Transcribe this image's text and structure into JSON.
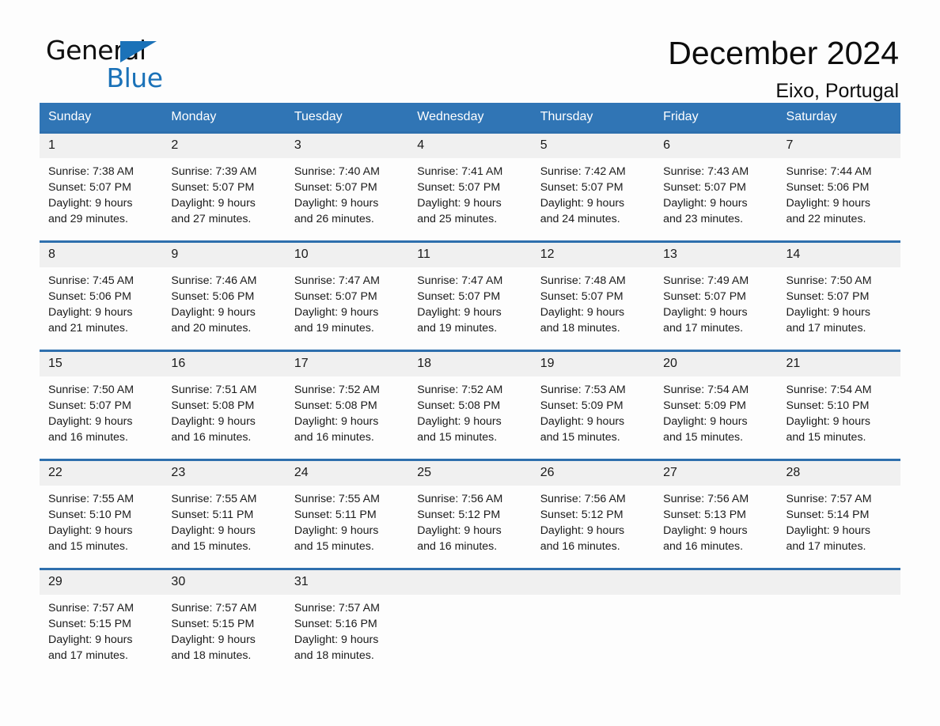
{
  "brand": {
    "name_part1": "General",
    "name_part2": "Blue",
    "triangle_color": "#1b72b8"
  },
  "header": {
    "title": "December 2024",
    "location": "Eixo, Portugal"
  },
  "theme": {
    "header_blue": "#3075b5",
    "row_border_blue": "#2e6fad",
    "daynum_band": "#f0f0f0",
    "page_background": "#fdfdfd"
  },
  "weekday_headers": [
    "Sunday",
    "Monday",
    "Tuesday",
    "Wednesday",
    "Thursday",
    "Friday",
    "Saturday"
  ],
  "weeks": [
    [
      {
        "day": "1",
        "sunrise": "Sunrise: 7:38 AM",
        "sunset": "Sunset: 5:07 PM",
        "daylight1": "Daylight: 9 hours",
        "daylight2": "and 29 minutes."
      },
      {
        "day": "2",
        "sunrise": "Sunrise: 7:39 AM",
        "sunset": "Sunset: 5:07 PM",
        "daylight1": "Daylight: 9 hours",
        "daylight2": "and 27 minutes."
      },
      {
        "day": "3",
        "sunrise": "Sunrise: 7:40 AM",
        "sunset": "Sunset: 5:07 PM",
        "daylight1": "Daylight: 9 hours",
        "daylight2": "and 26 minutes."
      },
      {
        "day": "4",
        "sunrise": "Sunrise: 7:41 AM",
        "sunset": "Sunset: 5:07 PM",
        "daylight1": "Daylight: 9 hours",
        "daylight2": "and 25 minutes."
      },
      {
        "day": "5",
        "sunrise": "Sunrise: 7:42 AM",
        "sunset": "Sunset: 5:07 PM",
        "daylight1": "Daylight: 9 hours",
        "daylight2": "and 24 minutes."
      },
      {
        "day": "6",
        "sunrise": "Sunrise: 7:43 AM",
        "sunset": "Sunset: 5:07 PM",
        "daylight1": "Daylight: 9 hours",
        "daylight2": "and 23 minutes."
      },
      {
        "day": "7",
        "sunrise": "Sunrise: 7:44 AM",
        "sunset": "Sunset: 5:06 PM",
        "daylight1": "Daylight: 9 hours",
        "daylight2": "and 22 minutes."
      }
    ],
    [
      {
        "day": "8",
        "sunrise": "Sunrise: 7:45 AM",
        "sunset": "Sunset: 5:06 PM",
        "daylight1": "Daylight: 9 hours",
        "daylight2": "and 21 minutes."
      },
      {
        "day": "9",
        "sunrise": "Sunrise: 7:46 AM",
        "sunset": "Sunset: 5:06 PM",
        "daylight1": "Daylight: 9 hours",
        "daylight2": "and 20 minutes."
      },
      {
        "day": "10",
        "sunrise": "Sunrise: 7:47 AM",
        "sunset": "Sunset: 5:07 PM",
        "daylight1": "Daylight: 9 hours",
        "daylight2": "and 19 minutes."
      },
      {
        "day": "11",
        "sunrise": "Sunrise: 7:47 AM",
        "sunset": "Sunset: 5:07 PM",
        "daylight1": "Daylight: 9 hours",
        "daylight2": "and 19 minutes."
      },
      {
        "day": "12",
        "sunrise": "Sunrise: 7:48 AM",
        "sunset": "Sunset: 5:07 PM",
        "daylight1": "Daylight: 9 hours",
        "daylight2": "and 18 minutes."
      },
      {
        "day": "13",
        "sunrise": "Sunrise: 7:49 AM",
        "sunset": "Sunset: 5:07 PM",
        "daylight1": "Daylight: 9 hours",
        "daylight2": "and 17 minutes."
      },
      {
        "day": "14",
        "sunrise": "Sunrise: 7:50 AM",
        "sunset": "Sunset: 5:07 PM",
        "daylight1": "Daylight: 9 hours",
        "daylight2": "and 17 minutes."
      }
    ],
    [
      {
        "day": "15",
        "sunrise": "Sunrise: 7:50 AM",
        "sunset": "Sunset: 5:07 PM",
        "daylight1": "Daylight: 9 hours",
        "daylight2": "and 16 minutes."
      },
      {
        "day": "16",
        "sunrise": "Sunrise: 7:51 AM",
        "sunset": "Sunset: 5:08 PM",
        "daylight1": "Daylight: 9 hours",
        "daylight2": "and 16 minutes."
      },
      {
        "day": "17",
        "sunrise": "Sunrise: 7:52 AM",
        "sunset": "Sunset: 5:08 PM",
        "daylight1": "Daylight: 9 hours",
        "daylight2": "and 16 minutes."
      },
      {
        "day": "18",
        "sunrise": "Sunrise: 7:52 AM",
        "sunset": "Sunset: 5:08 PM",
        "daylight1": "Daylight: 9 hours",
        "daylight2": "and 15 minutes."
      },
      {
        "day": "19",
        "sunrise": "Sunrise: 7:53 AM",
        "sunset": "Sunset: 5:09 PM",
        "daylight1": "Daylight: 9 hours",
        "daylight2": "and 15 minutes."
      },
      {
        "day": "20",
        "sunrise": "Sunrise: 7:54 AM",
        "sunset": "Sunset: 5:09 PM",
        "daylight1": "Daylight: 9 hours",
        "daylight2": "and 15 minutes."
      },
      {
        "day": "21",
        "sunrise": "Sunrise: 7:54 AM",
        "sunset": "Sunset: 5:10 PM",
        "daylight1": "Daylight: 9 hours",
        "daylight2": "and 15 minutes."
      }
    ],
    [
      {
        "day": "22",
        "sunrise": "Sunrise: 7:55 AM",
        "sunset": "Sunset: 5:10 PM",
        "daylight1": "Daylight: 9 hours",
        "daylight2": "and 15 minutes."
      },
      {
        "day": "23",
        "sunrise": "Sunrise: 7:55 AM",
        "sunset": "Sunset: 5:11 PM",
        "daylight1": "Daylight: 9 hours",
        "daylight2": "and 15 minutes."
      },
      {
        "day": "24",
        "sunrise": "Sunrise: 7:55 AM",
        "sunset": "Sunset: 5:11 PM",
        "daylight1": "Daylight: 9 hours",
        "daylight2": "and 15 minutes."
      },
      {
        "day": "25",
        "sunrise": "Sunrise: 7:56 AM",
        "sunset": "Sunset: 5:12 PM",
        "daylight1": "Daylight: 9 hours",
        "daylight2": "and 16 minutes."
      },
      {
        "day": "26",
        "sunrise": "Sunrise: 7:56 AM",
        "sunset": "Sunset: 5:12 PM",
        "daylight1": "Daylight: 9 hours",
        "daylight2": "and 16 minutes."
      },
      {
        "day": "27",
        "sunrise": "Sunrise: 7:56 AM",
        "sunset": "Sunset: 5:13 PM",
        "daylight1": "Daylight: 9 hours",
        "daylight2": "and 16 minutes."
      },
      {
        "day": "28",
        "sunrise": "Sunrise: 7:57 AM",
        "sunset": "Sunset: 5:14 PM",
        "daylight1": "Daylight: 9 hours",
        "daylight2": "and 17 minutes."
      }
    ],
    [
      {
        "day": "29",
        "sunrise": "Sunrise: 7:57 AM",
        "sunset": "Sunset: 5:15 PM",
        "daylight1": "Daylight: 9 hours",
        "daylight2": "and 17 minutes."
      },
      {
        "day": "30",
        "sunrise": "Sunrise: 7:57 AM",
        "sunset": "Sunset: 5:15 PM",
        "daylight1": "Daylight: 9 hours",
        "daylight2": "and 18 minutes."
      },
      {
        "day": "31",
        "sunrise": "Sunrise: 7:57 AM",
        "sunset": "Sunset: 5:16 PM",
        "daylight1": "Daylight: 9 hours",
        "daylight2": "and 18 minutes."
      },
      {
        "day": "",
        "sunrise": "",
        "sunset": "",
        "daylight1": "",
        "daylight2": ""
      },
      {
        "day": "",
        "sunrise": "",
        "sunset": "",
        "daylight1": "",
        "daylight2": ""
      },
      {
        "day": "",
        "sunrise": "",
        "sunset": "",
        "daylight1": "",
        "daylight2": ""
      },
      {
        "day": "",
        "sunrise": "",
        "sunset": "",
        "daylight1": "",
        "daylight2": ""
      }
    ]
  ]
}
